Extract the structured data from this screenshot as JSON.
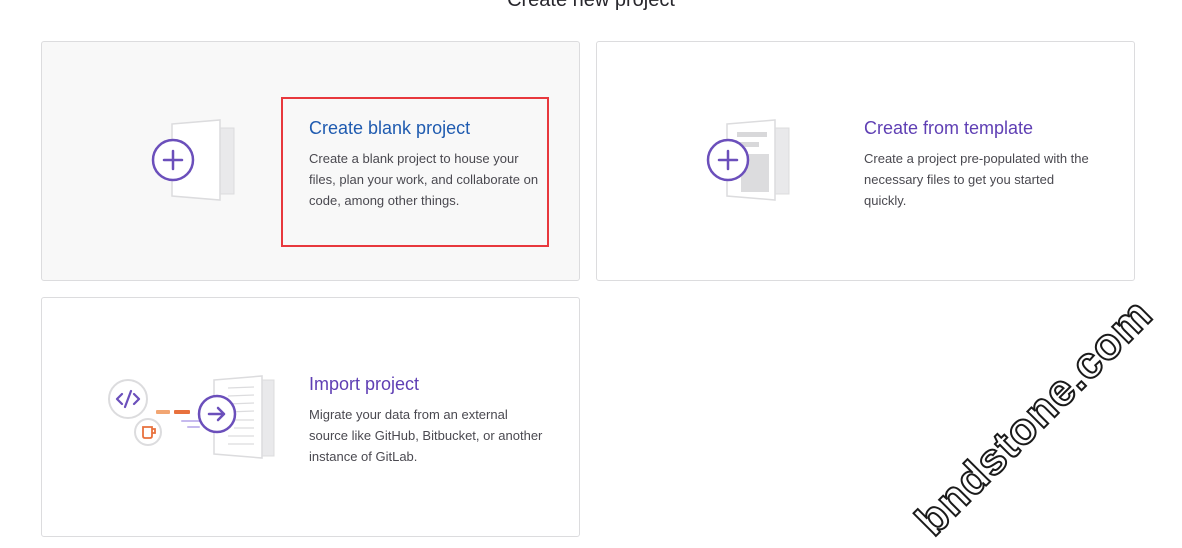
{
  "page": {
    "title": "Create new project"
  },
  "cards": [
    {
      "id": "blank",
      "title": "Create blank project",
      "description": "Create a blank project to house your files, plan your work, and collaborate on code, among other things.",
      "icon": "plus-icon"
    },
    {
      "id": "template",
      "title": "Create from template",
      "description": "Create a project pre-populated with the necessary files to get you started quickly.",
      "icon": "plus-icon"
    },
    {
      "id": "import",
      "title": "Import project",
      "description": "Migrate your data from an external source like GitHub, Bitbucket, or another instance of GitLab.",
      "icon": "arrow-right-icon"
    }
  ],
  "watermark": "bndstone.com",
  "colors": {
    "accent": "#6b4fbb",
    "title_blue": "#1f5bb0",
    "highlight": "#e8383d",
    "card_border": "#dcdcde"
  }
}
